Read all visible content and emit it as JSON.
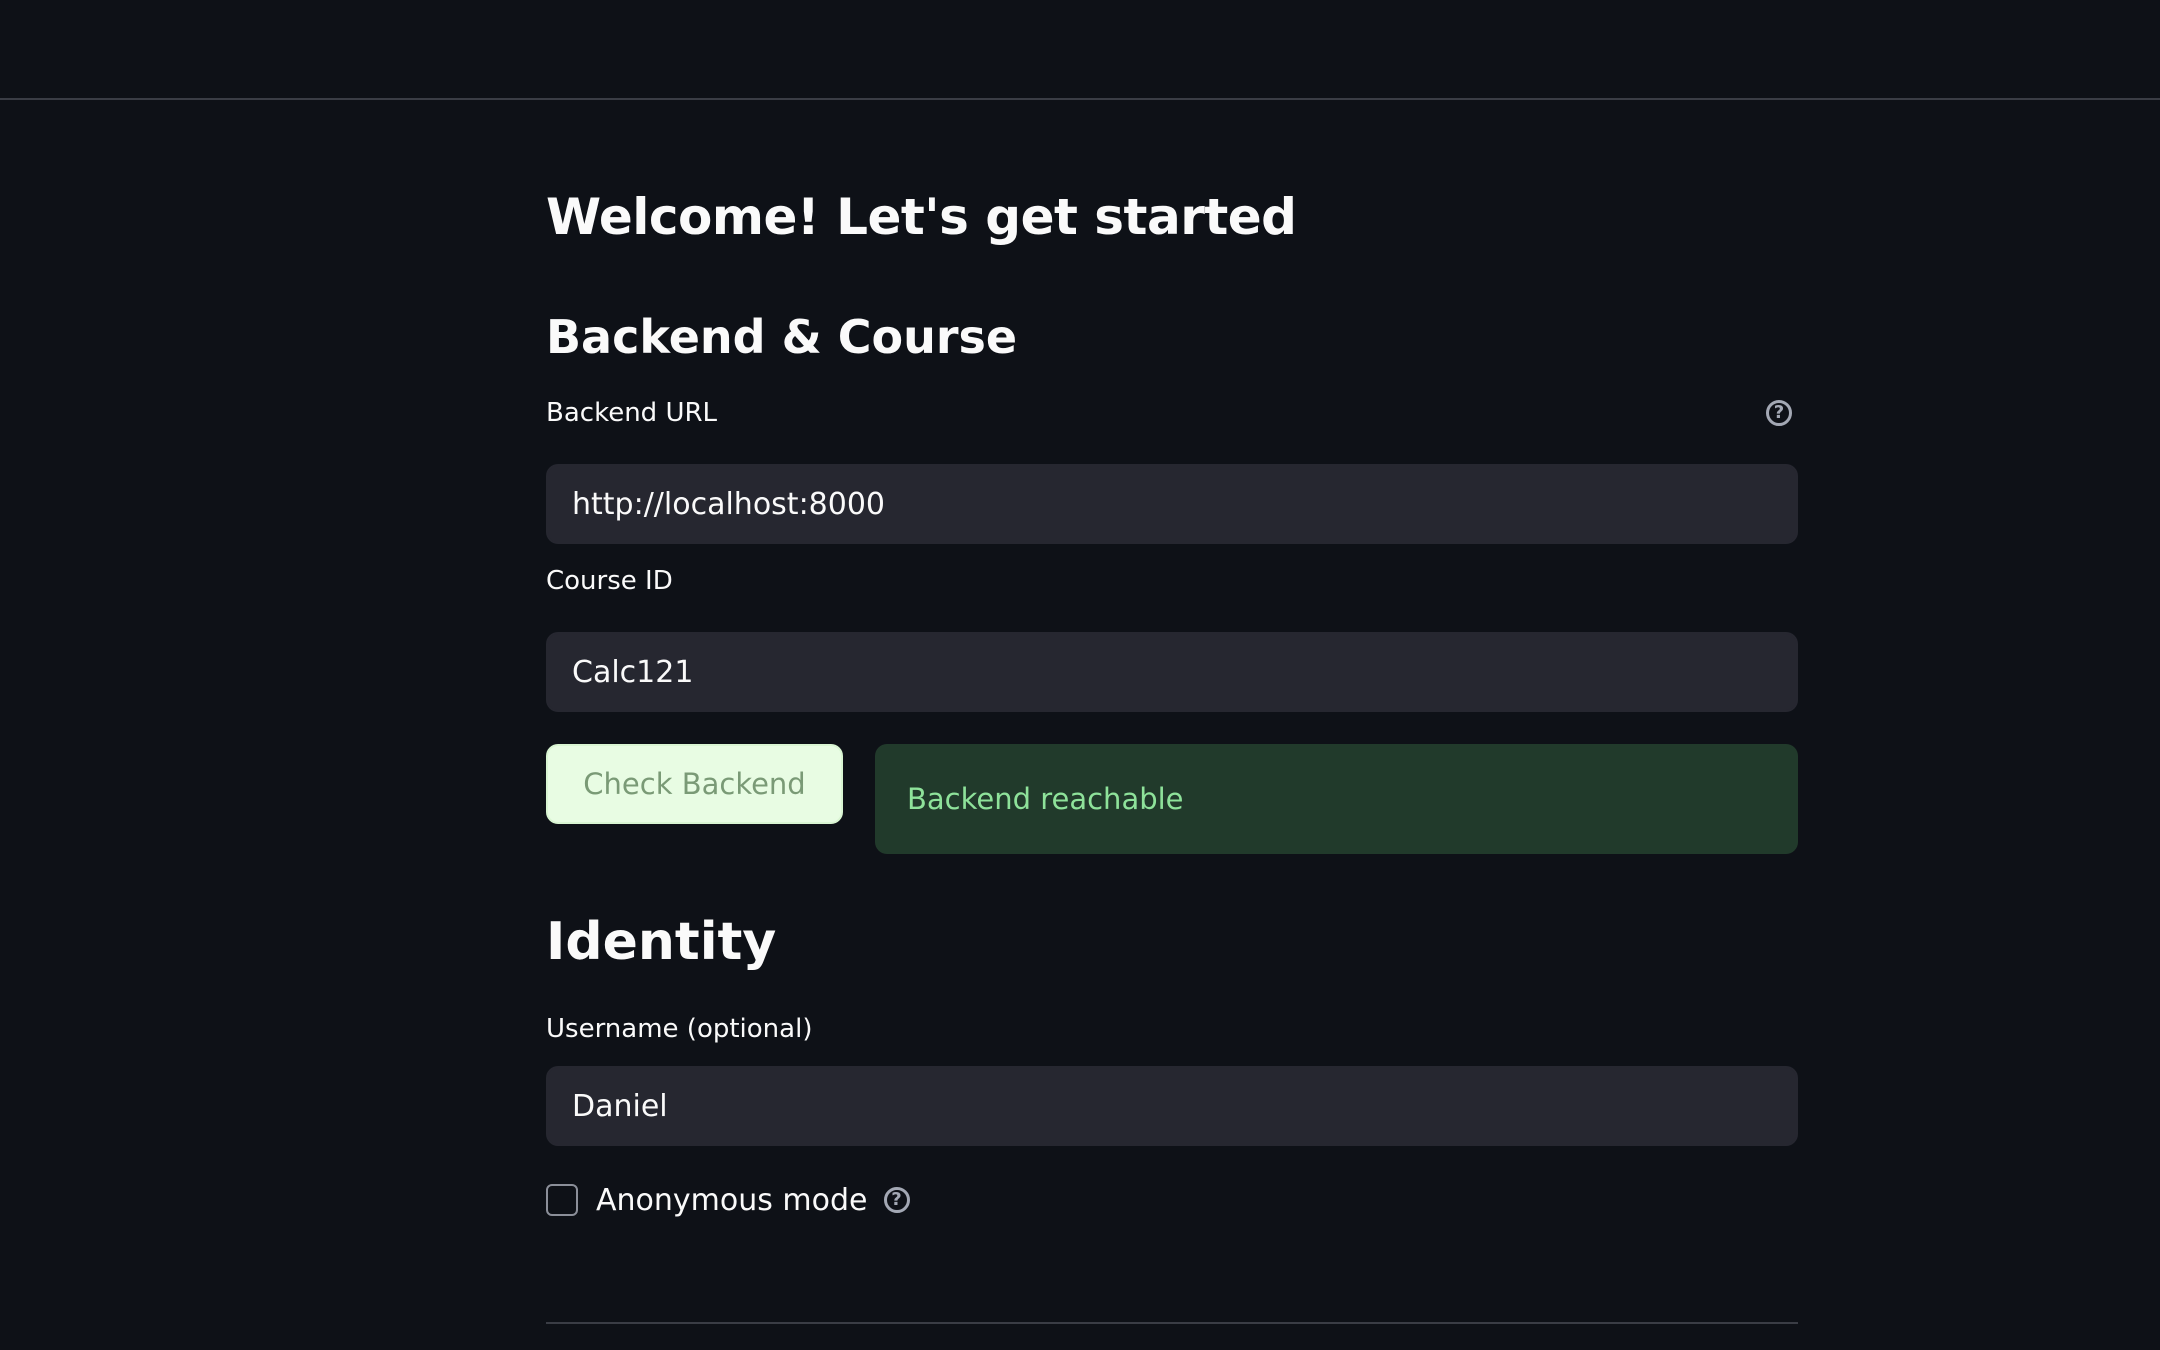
{
  "page": {
    "title": "Welcome! Let's get started"
  },
  "backend_section": {
    "title": "Backend & Course",
    "backend_url": {
      "label": "Backend URL",
      "value": "http://localhost:8000",
      "help_icon": "question-circle-icon"
    },
    "course_id": {
      "label": "Course ID",
      "value": "Calc121"
    },
    "check_button_label": "Check Backend",
    "status_message": "Backend reachable"
  },
  "identity_section": {
    "title": "Identity",
    "username": {
      "label": "Username (optional)",
      "value": "Daniel"
    },
    "anonymous_mode": {
      "label": "Anonymous mode",
      "checked": false,
      "help_icon": "question-circle-icon"
    }
  },
  "colors": {
    "background": "#0e1117",
    "input_background": "#262730",
    "button_background": "#e8fce3",
    "success_background": "#213a2b",
    "success_text": "#8ee29a"
  }
}
